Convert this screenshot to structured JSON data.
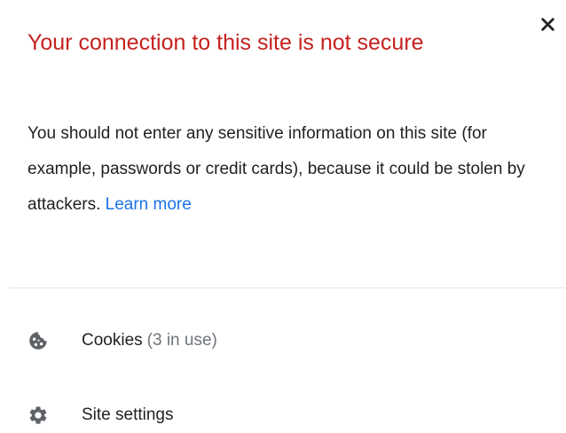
{
  "dialog": {
    "title": "Your connection to this site is not secure",
    "body": "You should not enter any sensitive information on this site (for example, passwords or credit cards), because it could be stolen by attackers.",
    "learn_more": "Learn more",
    "close_icon": "close-icon"
  },
  "rows": {
    "cookies": {
      "icon": "cookie-icon",
      "label": "Cookies",
      "count": "(3 in use)"
    },
    "site_settings": {
      "icon": "gear-icon",
      "label": "Site settings"
    }
  },
  "colors": {
    "title": "#c5221f",
    "text": "#202124",
    "secondary_text": "#70757a",
    "link": "#1a73e8",
    "icon": "#5f6368",
    "divider": "#e3e3e3"
  }
}
